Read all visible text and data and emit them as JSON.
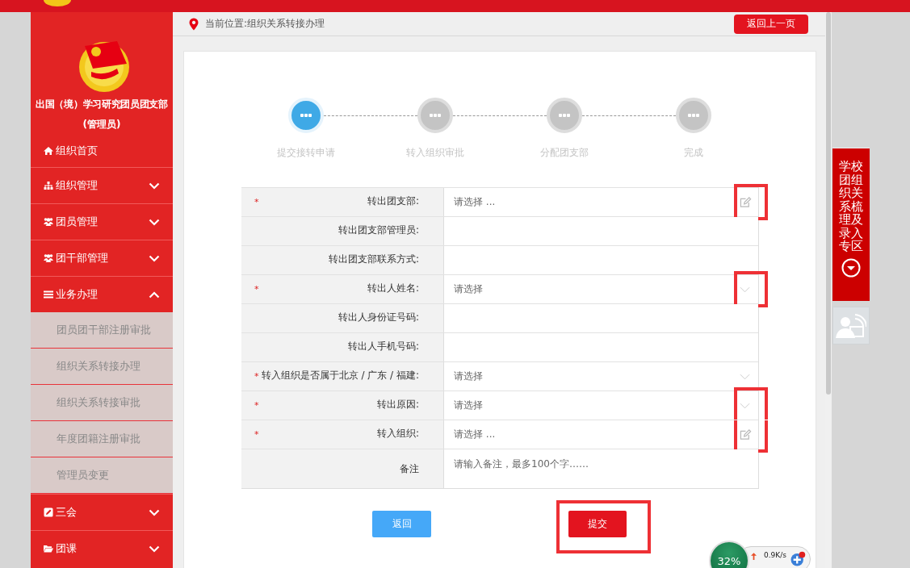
{
  "sidebar": {
    "title": "出国（境）学习研究团员团支部",
    "role": "(管理员)",
    "items": [
      {
        "label": "组织首页"
      },
      {
        "label": "组织管理",
        "expanded": false
      },
      {
        "label": "团员管理",
        "expanded": false
      },
      {
        "label": "团干部管理",
        "expanded": false
      },
      {
        "label": "业务办理",
        "expanded": true,
        "children": [
          {
            "label": "团员团干部注册审批"
          },
          {
            "label": "组织关系转接办理"
          },
          {
            "label": "组织关系转接审批"
          },
          {
            "label": "年度团籍注册审批"
          },
          {
            "label": "管理员变更"
          }
        ]
      },
      {
        "label": "三会",
        "expanded": false
      },
      {
        "label": "团课",
        "expanded": false
      }
    ]
  },
  "breadcrumb": "当前位置:组织关系转接办理",
  "back_top_button": "返回上一页",
  "steps": [
    {
      "label": "提交接转申请",
      "selected": true
    },
    {
      "label": "转入组织审批",
      "selected": false
    },
    {
      "label": "分配团支部",
      "selected": false
    },
    {
      "label": "完成",
      "selected": false
    }
  ],
  "form": [
    {
      "label": "转出团支部:",
      "marker": "*",
      "kind": "picker",
      "placeholder": "请选择 ...",
      "highlighted": true
    },
    {
      "label": "转出团支部管理员:",
      "kind": "text",
      "highlighted": false
    },
    {
      "label": "转出团支部联系方式:",
      "kind": "text",
      "highlighted": false
    },
    {
      "label": "转出人姓名:",
      "marker": "*",
      "kind": "select",
      "placeholder": "请选择",
      "highlighted": true
    },
    {
      "label": "转出人身份证号码:",
      "kind": "text",
      "highlighted": false
    },
    {
      "label": "转出人手机号码:",
      "kind": "text",
      "highlighted": false
    },
    {
      "label": "转入组织是否属于北京 / 广东 / 福建:",
      "marker": "*",
      "kind": "select",
      "placeholder": "请选择",
      "highlighted": false
    },
    {
      "label": "转出原因:",
      "marker": "*",
      "kind": "select",
      "placeholder": "请选择",
      "highlighted": true
    },
    {
      "label": "转入组织:",
      "marker": "*",
      "kind": "picker",
      "placeholder": "请选择 ...",
      "highlighted": true
    },
    {
      "label": "备注",
      "kind": "textarea",
      "placeholder": "请输入备注，最多100个字……",
      "highlighted": false
    }
  ],
  "buttons": [
    {
      "label": "返回",
      "kind": "back",
      "highlighted": false
    },
    {
      "label": "提交",
      "kind": "submit",
      "highlighted": true
    }
  ],
  "side_banner": "学校团组织关系梳理及录入专区",
  "speed_widget": {
    "percent": "32%",
    "upload": "0.9K/s"
  }
}
